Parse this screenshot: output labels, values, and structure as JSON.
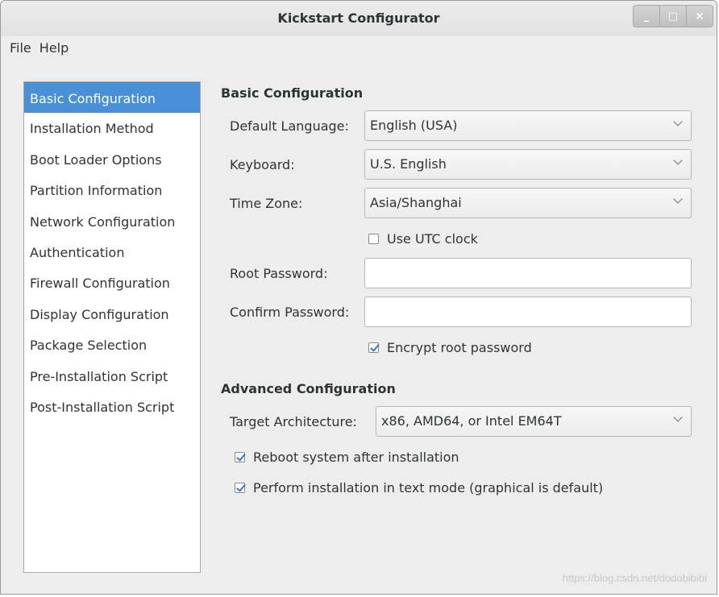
{
  "window": {
    "title": "Kickstart Configurator",
    "controls": [
      "_",
      "□",
      "×"
    ]
  },
  "menubar": [
    "File",
    "Help"
  ],
  "sidebar": {
    "items": [
      "Basic Configuration",
      "Installation Method",
      "Boot Loader Options",
      "Partition Information",
      "Network Configuration",
      "Authentication",
      "Firewall Configuration",
      "Display Configuration",
      "Package Selection",
      "Pre-Installation Script",
      "Post-Installation Script"
    ],
    "selected": "Basic Configuration"
  },
  "basic": {
    "title": "Basic Configuration",
    "default_language_label": "Default Language:",
    "default_language_value": "English (USA)",
    "keyboard_label": "Keyboard:",
    "keyboard_value": "U.S. English",
    "timezone_label": "Time Zone:",
    "timezone_value": "Asia/Shanghai",
    "utc_label": "Use UTC clock",
    "utc_checked": false,
    "root_password_label": "Root Password:",
    "root_password_value": "",
    "confirm_password_label": "Confirm Password:",
    "confirm_password_value": "",
    "encrypt_label": "Encrypt root password",
    "encrypt_checked": true
  },
  "advanced": {
    "title": "Advanced Configuration",
    "target_arch_label": "Target Architecture:",
    "target_arch_value": "x86, AMD64, or Intel EM64T",
    "reboot_label": "Reboot system after installation",
    "reboot_checked": true,
    "textmode_label": "Perform installation in text mode (graphical is default)",
    "textmode_checked": true
  },
  "watermark": "https://blog.csdn.net/dodobibibi",
  "colors": {
    "accent": "#4a90d9",
    "check": "#3c76c3"
  }
}
